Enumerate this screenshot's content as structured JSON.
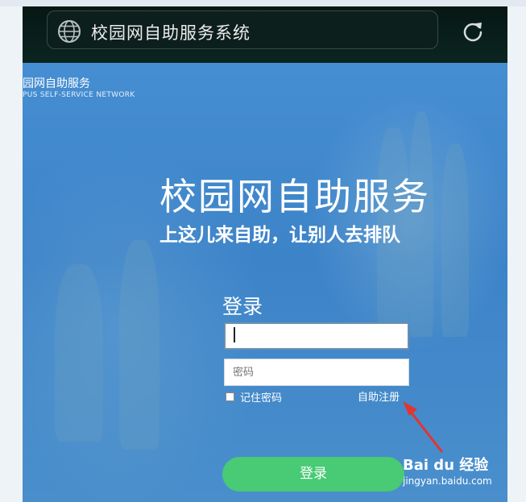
{
  "browser": {
    "address_title": "校园网自助服务系统",
    "icons": {
      "site": "globe-icon",
      "reload": "reload-icon"
    }
  },
  "brand": {
    "name_cn": "园网自助服务",
    "name_en": "PUS  SELF-SERVICE NETWORK"
  },
  "hero": {
    "title": "校园网自助服务",
    "subtitle": "上这儿来自助，让别人去排队"
  },
  "login": {
    "heading": "登录",
    "username_value": "",
    "password_placeholder": "密码",
    "remember_label": "记住密码",
    "register_link": "自助注册",
    "submit_label": "登录"
  },
  "watermark": {
    "logo_text": "Bai du 经验",
    "url": "jingyan.baidu.com"
  },
  "colors": {
    "page_blue": "#3f86c9",
    "button_green": "#49ca74",
    "annotation_red": "#e3342f"
  }
}
